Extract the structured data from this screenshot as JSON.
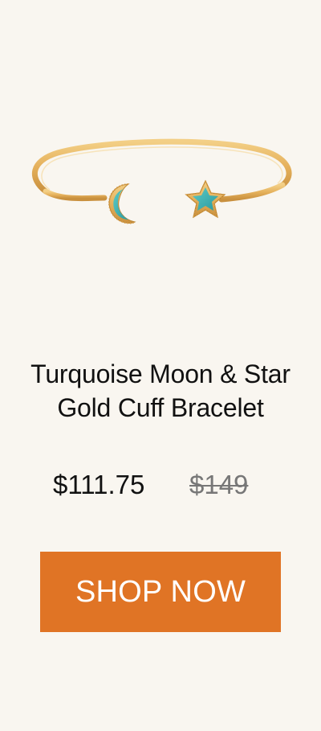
{
  "product": {
    "image_icon": "bracelet-image",
    "title_line1": "Turquoise Moon & Star",
    "title_line2": "Gold Cuff Bracelet",
    "sale_price": "$111.75",
    "original_price": "$149"
  },
  "cta": {
    "label": "SHOP NOW"
  },
  "colors": {
    "background": "#f9f6f0",
    "gold": "#e5b15c",
    "turquoise": "#3ab5b5",
    "button": "#e07425",
    "button_text": "#ffffff",
    "strikethrough_text": "#777777"
  }
}
